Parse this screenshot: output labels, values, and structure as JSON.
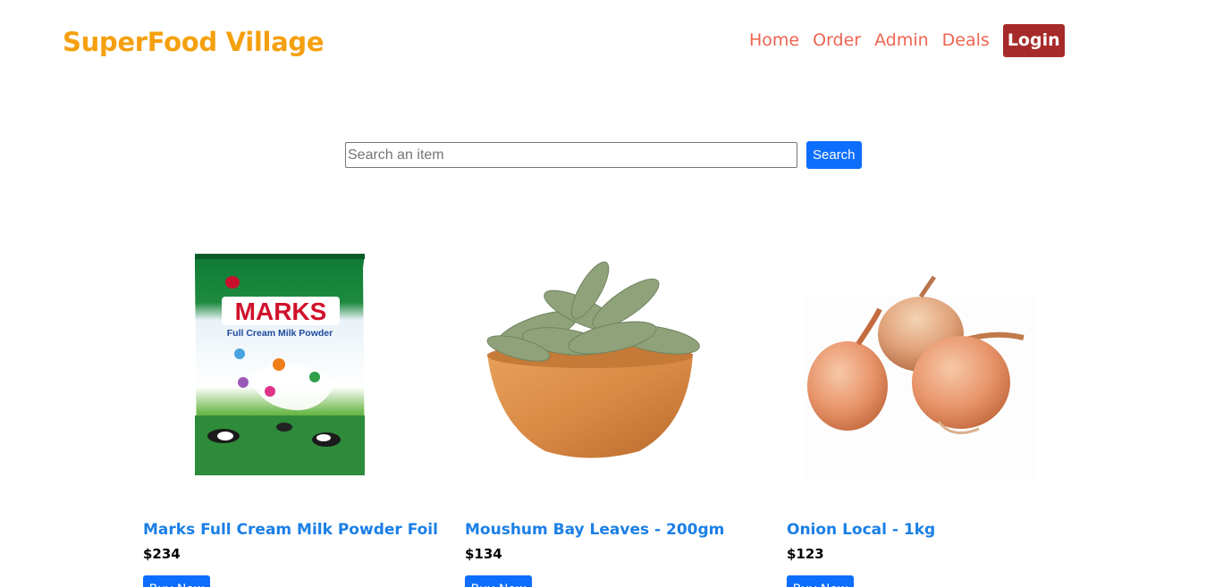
{
  "brand": "SuperFood Village",
  "nav": {
    "home": "Home",
    "order": "Order",
    "admin": "Admin",
    "deals": "Deals",
    "login": "Login"
  },
  "search": {
    "placeholder": "Search an item",
    "button": "Search"
  },
  "products": [
    {
      "name": "Marks Full Cream Milk Powder Foil",
      "price": "$234",
      "button": "Buy Now",
      "pack_brand": "MARKS",
      "pack_sub": "Full Cream Milk Powder"
    },
    {
      "name": "Moushum Bay Leaves - 200gm",
      "price": "$134",
      "button": "Buy Now"
    },
    {
      "name": "Onion Local - 1kg",
      "price": "$123",
      "button": "Buy Now"
    }
  ],
  "colors": {
    "brand": "#f5a00f",
    "nav": "#ee6450",
    "login_bg": "#a72a2a",
    "primary": "#0d6efd",
    "product_title": "#1a7fe6"
  }
}
